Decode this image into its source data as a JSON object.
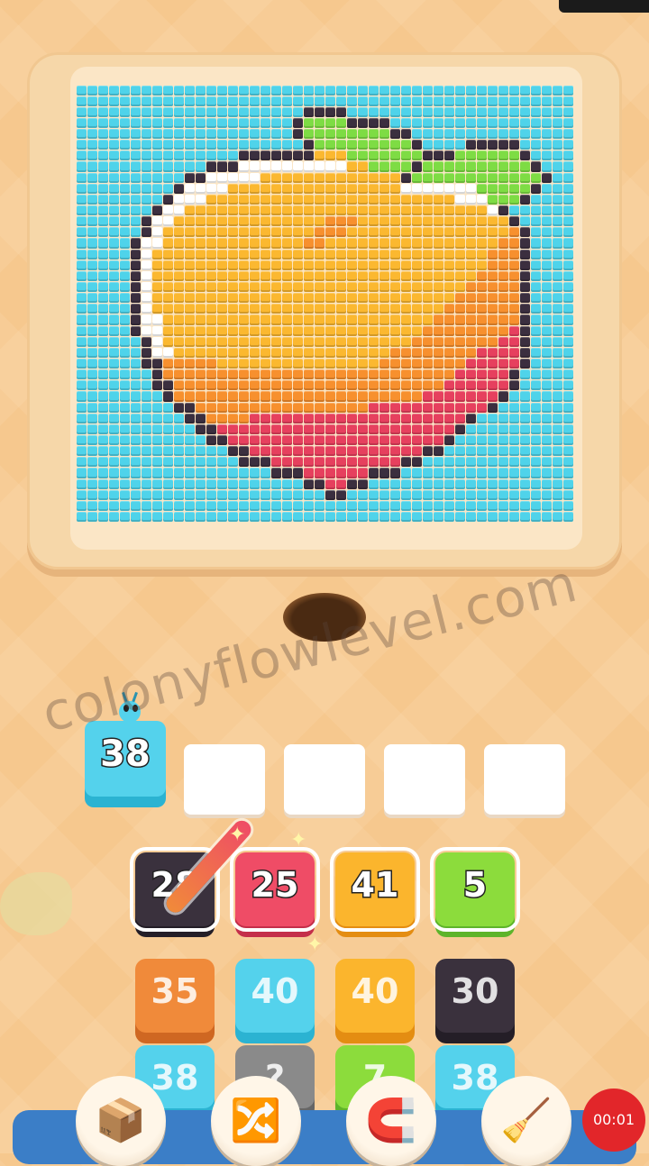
{
  "watermark": "colonyflowlevel.com",
  "queue": {
    "number": "38",
    "color": "#54d2ec"
  },
  "slots_count": 4,
  "board": {
    "rows": [
      {
        "tiles": [
          {
            "number": "28",
            "color": "#3a313d",
            "shade": "#241e27",
            "selected": true
          },
          {
            "number": "25",
            "color": "#ef4c66",
            "shade": "#c42f4a",
            "selected": true
          },
          {
            "number": "41",
            "color": "#fbb52d",
            "shade": "#e48d12",
            "selected": true
          },
          {
            "number": "5",
            "color": "#8cdc3c",
            "shade": "#5eb42a",
            "selected": true
          }
        ]
      },
      {
        "tiles": [
          {
            "number": "35",
            "color": "#f08a3a",
            "shade": "#cf6722",
            "selected": false
          },
          {
            "number": "40",
            "color": "#54d2ec",
            "shade": "#2bb3d2",
            "selected": false
          },
          {
            "number": "40",
            "color": "#fbb52d",
            "shade": "#e48d12",
            "selected": false
          },
          {
            "number": "30",
            "color": "#3a313d",
            "shade": "#241e27",
            "selected": false
          }
        ]
      },
      {
        "tiles": [
          {
            "number": "38",
            "color": "#54d2ec",
            "shade": "#2bb3d2",
            "selected": false
          },
          {
            "number": "?",
            "color": "#8a8a8a",
            "shade": "#666666",
            "selected": false
          },
          {
            "number": "7",
            "color": "#8cdc3c",
            "shade": "#5eb42a",
            "selected": false
          },
          {
            "number": "38",
            "color": "#54d2ec",
            "shade": "#2bb3d2",
            "selected": false
          }
        ]
      }
    ]
  },
  "boosters": [
    {
      "name": "add-slot",
      "icon": "add-box-icon",
      "glyph": "📦"
    },
    {
      "name": "shuffle",
      "icon": "shuffle-arrows-icon",
      "glyph": "🔀"
    },
    {
      "name": "magnet",
      "icon": "magnet-claw-icon",
      "glyph": "🧲"
    },
    {
      "name": "vacuum",
      "icon": "vacuum-icon",
      "glyph": "🧹"
    }
  ],
  "recording_timer": "00:01",
  "palette": {
    "B": "#4fd3ea",
    "K": "#3b2f3f",
    "W": "#ffffff",
    "Y": "#fbb830",
    "O": "#f7902e",
    "R": "#e6405e",
    "G": "#7edc44",
    "L": "#f5a623"
  },
  "pixel_art": [
    "BBBBBBBBBBBBBBBBBBBBBBBBBBBBBBBBBBBBBBBBBBBBBB",
    "BBBBBBBBBBBBBBBBBBBBBBBBBBBBBBBBBBBBBBBBBBBBBB",
    "BBBBBBBBBBBBBBBBBBBBBKKKKBBBBBBBBBBBBBBBBBBBBB",
    "BBBBBBBBBBBBBBBBBBBBKGGGGKKKKBBBBBBBBBBBBBBBBB",
    "BBBBBBBBBBBBBBBBBBBBKGGGGGGGGKKBBBBBBBBBBBBBBB",
    "BBBBBBBBBBBBBBBBBBBBBKGGGGGGGGGKBBBBKKKKKBBBBB",
    "BBBBBBBBBBBBBBBKKKKKKKYYYGGGGGGGKKKGGGGGGKBBBB",
    "BBBBBBBBBBBBKKKWWWWWWWWWWYYGGGGKGGGGGGGGGGKBBB",
    "BBBBBBBBBBKKWWWWWYYYYYYYYYYYYYKGGGGGGGGGGGGKBB",
    "BBBBBBBBBKWWWWYYYYYYYYYYYYYYYYWWWWWWWGGGGGKBBB",
    "BBBBBBBBKWWWYYYYYYYYYYYYYYYYYYYYYYYWWWGGGKBBBB",
    "BBBBBBBKWWYYYYYYYYYYYYYYYYYYYYYYYYYYYYWKBBBBBB",
    "BBBBBBKWWYYYYYYYYYYYYYYOOOYYYYYYYYYYYYYYKBBBBB",
    "BBBBBBKWYYYYYYYYYYYYYYOOOYYYYYYYYYYYYYYYOKBBBB",
    "BBBBBKWWYYYYYYYYYYYYYOOYYYYYYYYYYYYYYYYOOKBBBB",
    "BBBBBKWYYYYYYYYYYYYYYYYYYYYYYYYYYYYYYYOOOKBBBB",
    "BBBBBKWYYYYYYYYYYYYYYYYYYYYYYYYYYYYYYYOOOKBBBB",
    "BBBBBKWYYYYYYYYYYYYYYYYYYYYYYYYYYYYYYOOOOKBBBB",
    "BBBBBKWYYYYYYYYYYYYYYYYYYYYYYYYYYYYYOOOOOKBBBB",
    "BBBBBKWYYYYYYYYYYYYYYYYYYYYYYYYYYYYOOOOOOKBBBB",
    "BBBBBKWYYYYYYYYYYYYYYYYYYYYYYYYYYYOOOOOOOKBBBB",
    "BBBBBKWWYYYYYYYYYYYYYYYYYYYYYYYYYOOOOOOOOKBBBB",
    "BBBBBKWWYYYYYYYYYYYYYYYYYYYYYYYYOOOOOOOORKBBBB",
    "BBBBBBKWYYYYYYYYYYYYYYYYYYYYYYYOOOOOOOORRKBBBB",
    "BBBBBBKWWYYYYYYYYYYYYYYYYYYYYOOOOOOOORRRRKBBBB",
    "BBBBBBKKOOOOOYYYYYYYYYYYYYYYOOOOOOOORRRRRKBBBB",
    "BBBBBBBKOOOOOOOOOOOOOOOOOOOOOOOOOOORRRRRKBBBBB",
    "BBBBBBBKKOOOOOOOOOOOOOOOOOOOOOOOOORRRRRRKBBBBB",
    "BBBBBBBBKOOOOOOOOOOOOOOOOOOOOOOORRRRRRRKBBBBBB",
    "BBBBBBBBBKKOOOOOOOOOOOOOOOORRRRRRRRRRRKBBBBBBB",
    "BBBBBBBBBBKKOOOORRRRRRRRRRRRRRRRRRRRKBBBBBBBBB",
    "BBBBBBBBBBBKKRRRRRRRRRRRRRRRRRRRRRRKBBBBBBBBBB",
    "BBBBBBBBBBBBKKRRRRRRRRRRRRRRRRRRRRKBBBBBBBBBBB",
    "BBBBBBBBBBBBBBKKRRRRRRRRRRRRRRRRKKBBBBBBBBBBBB",
    "BBBBBBBBBBBBBBBKKKRRRRRRRRRRRRKKBBBBBBBBBBBBBB",
    "BBBBBBBBBBBBBBBBBBKKKRRRRRRKKKBBBBBBBBBBBBBBBB",
    "BBBBBBBBBBBBBBBBBBBBBKKRRKKBBBBBBBBBBBBBBBBBBB",
    "BBBBBBBBBBBBBBBBBBBBBBBKKBBBBBBBBBBBBBBBBBBBBB",
    "BBBBBBBBBBBBBBBBBBBBBBBBBBBBBBBBBBBBBBBBBBBBBB",
    "BBBBBBBBBBBBBBBBBBBBBBBBBBBBBBBBBBBBBBBBBBBBBB"
  ]
}
